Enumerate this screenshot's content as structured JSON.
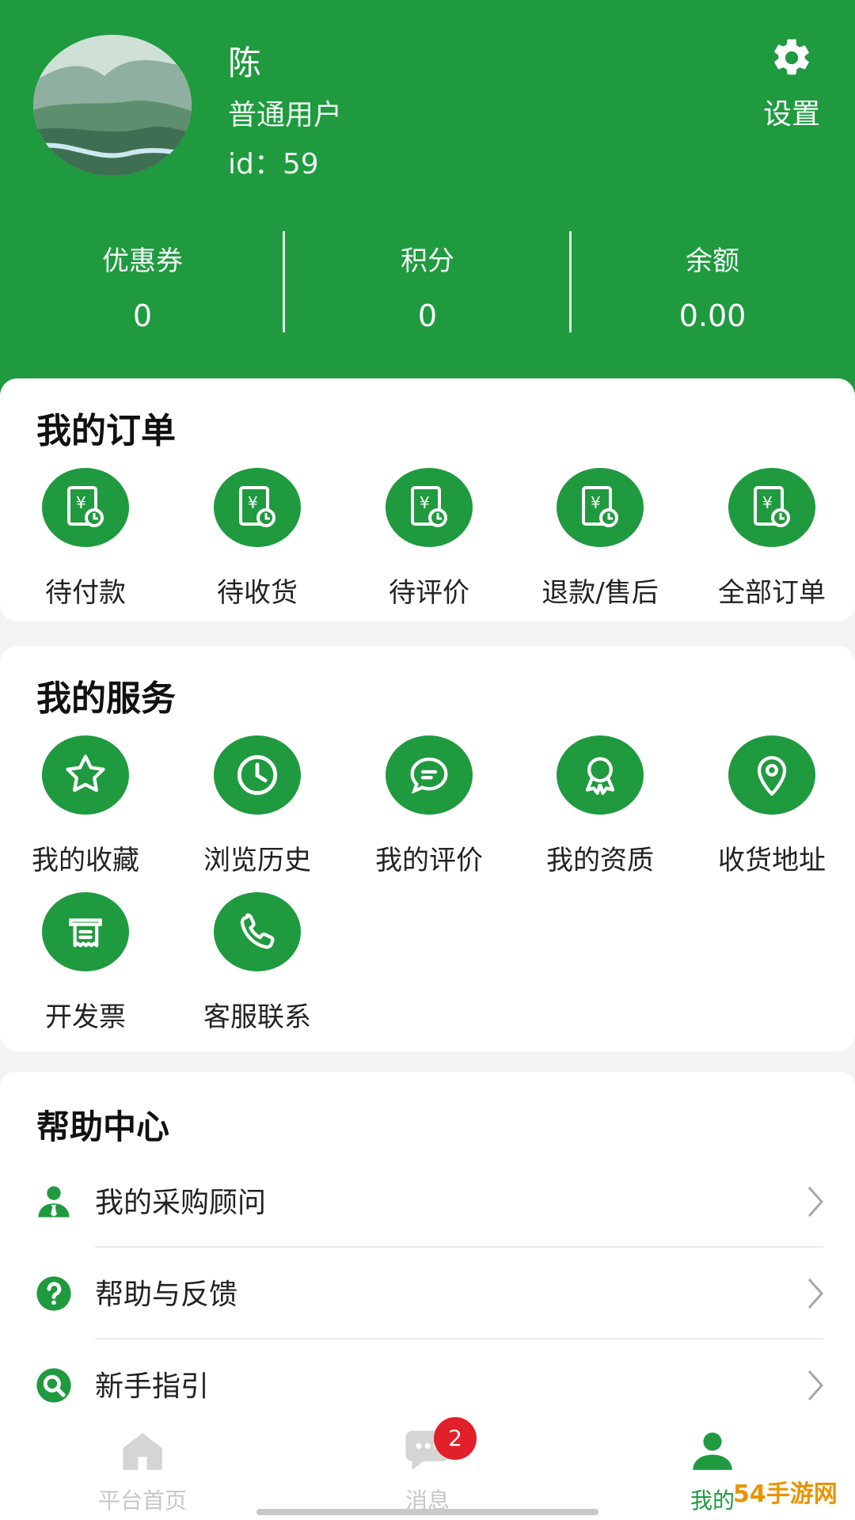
{
  "header": {
    "name": "陈",
    "user_type": "普通用户",
    "user_id": "id：59",
    "settings_label": "设置",
    "colors": {
      "primary": "#1f9a3f"
    }
  },
  "stats": [
    {
      "label": "优惠券",
      "value": "0"
    },
    {
      "label": "积分",
      "value": "0"
    },
    {
      "label": "余额",
      "value": "0.00"
    }
  ],
  "orders": {
    "title": "我的订单",
    "items": [
      {
        "label": "待付款",
        "icon": "receipt-clock-icon"
      },
      {
        "label": "待收货",
        "icon": "receipt-clock-icon"
      },
      {
        "label": "待评价",
        "icon": "receipt-clock-icon"
      },
      {
        "label": "退款/售后",
        "icon": "receipt-clock-icon"
      },
      {
        "label": "全部订单",
        "icon": "receipt-clock-icon"
      }
    ]
  },
  "services": {
    "title": "我的服务",
    "items": [
      {
        "label": "我的收藏",
        "icon": "star-icon"
      },
      {
        "label": "浏览历史",
        "icon": "clock-icon"
      },
      {
        "label": "我的评价",
        "icon": "chat-bubble-icon"
      },
      {
        "label": "我的资质",
        "icon": "award-badge-icon"
      },
      {
        "label": "收货地址",
        "icon": "location-pin-icon"
      },
      {
        "label": "开发票",
        "icon": "invoice-printer-icon"
      },
      {
        "label": "客服联系",
        "icon": "phone-icon"
      }
    ]
  },
  "help": {
    "title": "帮助中心",
    "items": [
      {
        "label": "我的采购顾问",
        "icon": "advisor-icon"
      },
      {
        "label": "帮助与反馈",
        "icon": "question-icon"
      },
      {
        "label": "新手指引",
        "icon": "search-icon"
      }
    ]
  },
  "bottom_nav": {
    "items": [
      {
        "label": "平台首页",
        "icon": "home-icon"
      },
      {
        "label": "消息",
        "icon": "message-icon"
      },
      {
        "label": "我的",
        "icon": "user-icon"
      }
    ],
    "badge": "2"
  },
  "watermark": "54手游网"
}
